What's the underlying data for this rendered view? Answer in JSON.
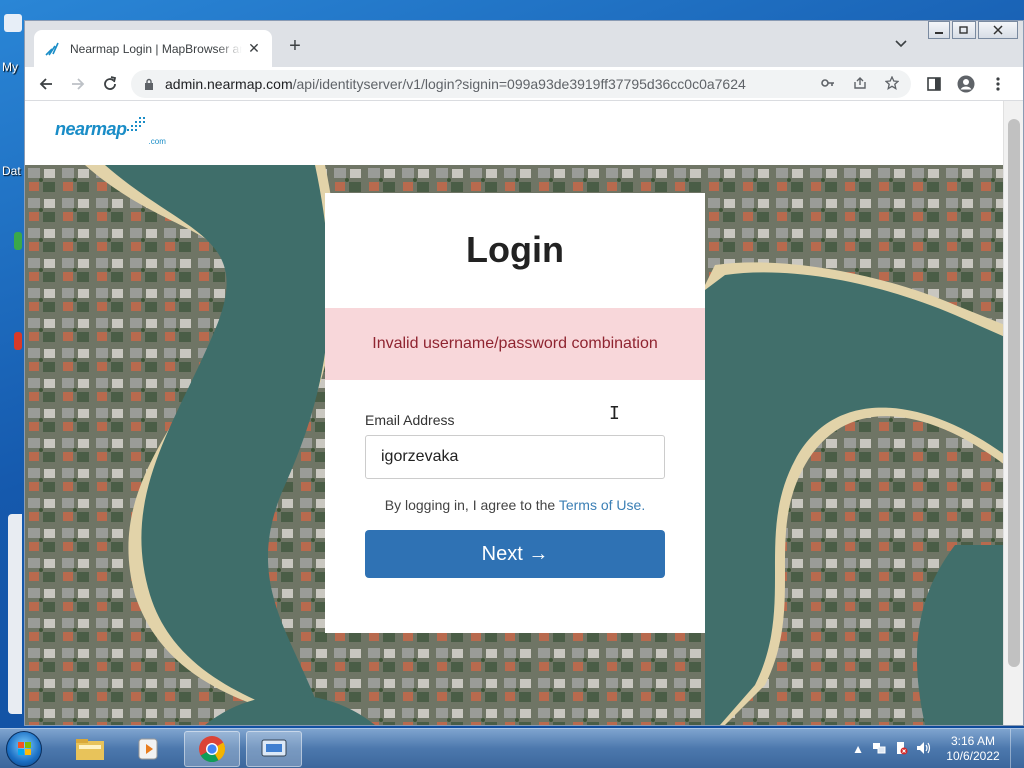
{
  "desktop": {
    "labels": [
      "My",
      "Dat"
    ]
  },
  "browser": {
    "tab_title": "Nearmap Login | MapBrowser and",
    "new_tab_symbol": "+",
    "tab_close_symbol": "✕",
    "url_host": "admin.nearmap.com",
    "url_path": "/api/identityserver/v1/login?signin=099a93de3919ff37795d36cc0c0a7624",
    "window_controls": [
      "minimize",
      "restore",
      "close"
    ]
  },
  "page": {
    "logo_text": "nearmap",
    "logo_suffix": ".com",
    "login": {
      "title": "Login",
      "error_message": "Invalid username/password combination",
      "email_label": "Email Address",
      "email_value": "igorzevaka",
      "terms_prefix": "By logging in, I agree to the ",
      "terms_link": "Terms of Use.",
      "next_button": "Next →"
    }
  },
  "taskbar": {
    "time": "3:16 AM",
    "date": "10/6/2022",
    "apps": [
      "explorer",
      "media-player",
      "chrome",
      "remote-desktop"
    ]
  },
  "colors": {
    "brand": "#1a8dc7",
    "error_bg": "#f8d7da",
    "error_text": "#8f2430",
    "button": "#2f72b4",
    "link": "#3b7fb5"
  }
}
